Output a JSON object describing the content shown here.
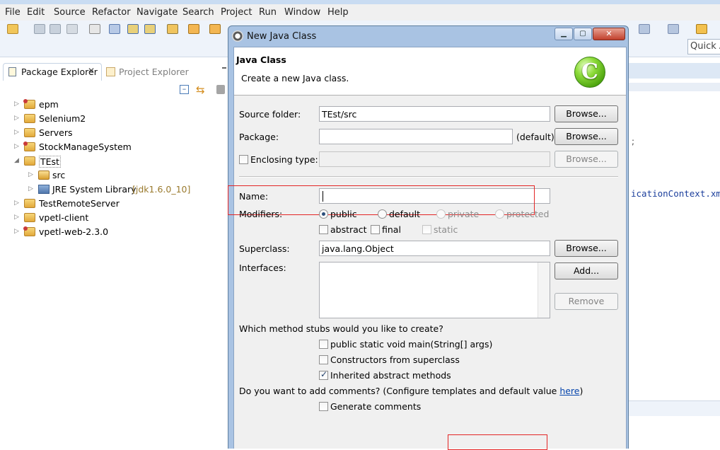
{
  "ide": {
    "menus": [
      "File",
      "Edit",
      "Source",
      "Refactor",
      "Navigate",
      "Search",
      "Project",
      "Run",
      "Window",
      "Help"
    ],
    "quick_access": "Quick A",
    "package_explorer": {
      "tab_label": "Package Explorer",
      "other_tab_label": "Project Explorer",
      "tree": [
        {
          "label": "epm",
          "arrow": "▷",
          "icon": "project-icon",
          "overlay": true
        },
        {
          "label": "Selenium2",
          "arrow": "▷",
          "icon": "project-icon",
          "overlay": false
        },
        {
          "label": "Servers",
          "arrow": "▷",
          "icon": "folder-icon",
          "overlay": false
        },
        {
          "label": "StockManageSystem",
          "arrow": "▷",
          "icon": "project-icon",
          "overlay": true
        },
        {
          "label": "TEst",
          "arrow": "◢",
          "icon": "project-icon",
          "overlay": false
        },
        {
          "label": "src",
          "arrow": "▷",
          "icon": "package-folder-icon",
          "overlay": false
        },
        {
          "label": "JRE System Library",
          "suffix": "[jdk1.6.0_10]",
          "arrow": "▷",
          "icon": "library-icon",
          "overlay": false
        },
        {
          "label": "TestRemoteServer",
          "arrow": "▷",
          "icon": "project-icon",
          "overlay": false
        },
        {
          "label": "vpetl-client",
          "arrow": "▷",
          "icon": "project-icon",
          "overlay": false
        },
        {
          "label": "vpetl-web-2.3.0",
          "arrow": "▷",
          "icon": "project-icon",
          "overlay": true
        }
      ]
    },
    "editor_snippet": "icationContext.xml"
  },
  "dialog": {
    "title": "New Java Class",
    "banner_title": "Java Class",
    "banner_desc": "Create a new Java class.",
    "banner_logo": "C",
    "source_folder": {
      "label": "Source folder:",
      "value": "TEst/src",
      "button": "Browse..."
    },
    "package": {
      "label": "Package:",
      "value": "",
      "hint": "(default)",
      "button": "Browse..."
    },
    "enclosing_type": {
      "label": "Enclosing type:",
      "value": "",
      "button": "Browse...",
      "checked": false
    },
    "name": {
      "label": "Name:",
      "value": ""
    },
    "modifiers": {
      "label": "Modifiers:",
      "access": [
        {
          "label": "public",
          "selected": true,
          "enabled": true
        },
        {
          "label": "default",
          "selected": false,
          "enabled": true
        },
        {
          "label": "private",
          "selected": false,
          "enabled": false
        },
        {
          "label": "protected",
          "selected": false,
          "enabled": false
        }
      ],
      "flags": [
        {
          "label": "abstract",
          "checked": false,
          "enabled": true
        },
        {
          "label": "final",
          "checked": false,
          "enabled": true
        },
        {
          "label": "static",
          "checked": false,
          "enabled": false
        }
      ]
    },
    "superclass": {
      "label": "Superclass:",
      "value": "java.lang.Object",
      "button": "Browse..."
    },
    "interfaces": {
      "label": "Interfaces:",
      "add_button": "Add...",
      "remove_button": "Remove"
    },
    "stubs": {
      "question": "Which method stubs would you like to create?",
      "options": [
        {
          "label": "public static void main(String[] args)",
          "checked": false
        },
        {
          "label": "Constructors from superclass",
          "checked": false
        },
        {
          "label": "Inherited abstract methods",
          "checked": true
        }
      ]
    },
    "comments": {
      "question": "Do you want to add comments? (Configure templates and default value ",
      "link": "here",
      "question_end": ")",
      "option": {
        "label": "Generate comments",
        "checked": false
      }
    }
  },
  "colors": {
    "highlight_box": "#e32525",
    "link": "#0645ad"
  }
}
